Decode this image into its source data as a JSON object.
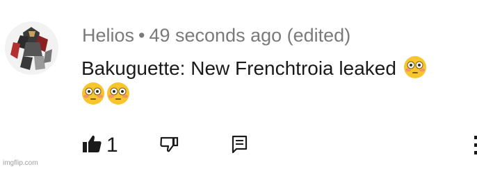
{
  "comment": {
    "author": "Helios",
    "separator": "•",
    "timestamp": "49 seconds ago (edited)",
    "text": "Bakuguette: New Frenchtroia leaked",
    "emojis": [
      "flushed-face-emoji",
      "flushed-face-emoji",
      "flushed-face-emoji"
    ]
  },
  "actions": {
    "like_icon": "thumbs-up-filled-icon",
    "like_count": "1",
    "dislike_icon": "thumbs-down-outline-icon",
    "reply_icon": "comment-icon",
    "more_icon": "more-vertical-icon"
  },
  "colors": {
    "meta_text": "#7a7a7a",
    "body_text": "#1a1a1a",
    "emoji_face": "#f7c52c"
  },
  "watermark": "imgflip.com"
}
